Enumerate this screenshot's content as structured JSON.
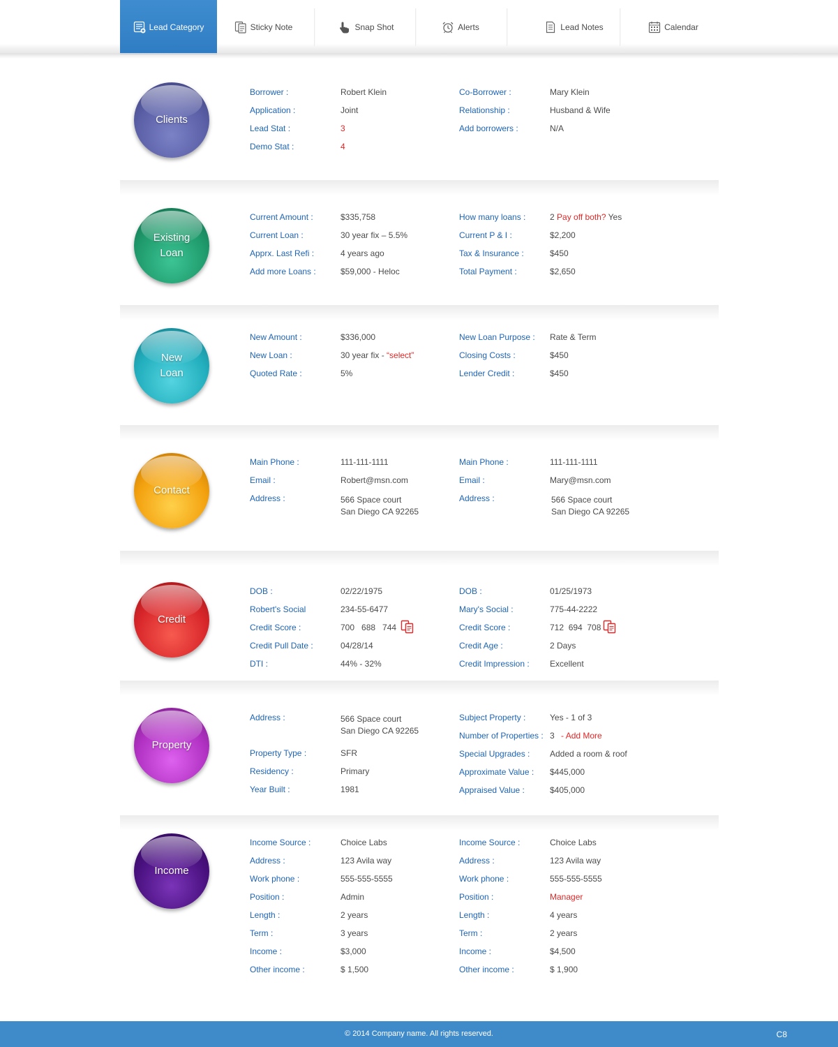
{
  "nav": {
    "tabs": [
      {
        "label": "Lead Category",
        "icon": "list-icon"
      },
      {
        "label": "Sticky Note",
        "icon": "notes-icon"
      },
      {
        "label": "Snap Shot",
        "icon": "pointer-icon"
      },
      {
        "label": "Alerts",
        "icon": "alarm-clock-icon"
      },
      {
        "label": "Lead Notes",
        "icon": "document-icon"
      },
      {
        "label": "Calendar",
        "icon": "calendar-icon"
      }
    ]
  },
  "sections": {
    "clients": {
      "title": "Clients",
      "left": [
        {
          "label": "Borrower :",
          "value": "Robert Klein"
        },
        {
          "label": "Application :",
          "value": "Joint"
        },
        {
          "label": "Lead Stat :",
          "value": "3"
        },
        {
          "label": "Demo Stat :",
          "value": "4"
        }
      ],
      "right": [
        {
          "label": "Co-Borrower :",
          "value": "Mary Klein"
        },
        {
          "label": "Relationship :",
          "value": "Husband & Wife"
        },
        {
          "label": "Add borrowers :",
          "value": "N/A"
        }
      ]
    },
    "existing_loan": {
      "title": "Existing\nLoan",
      "left": [
        {
          "label": "Current Amount :",
          "value": "$335,758"
        },
        {
          "label": "Current Loan :",
          "value": "30 year fix – 5.5%"
        },
        {
          "label": "Apprx. Last Refi :",
          "value": "4 years ago"
        },
        {
          "label": "Add more Loans :",
          "value": "$59,000 - Heloc"
        }
      ],
      "right": [
        {
          "label": "How many loans :",
          "value": "2",
          "value_red": "Pay off both?",
          "value_tail": "Yes"
        },
        {
          "label": "Current P & I :",
          "value": "$2,200"
        },
        {
          "label": "Tax & Insurance :",
          "value": "$450"
        },
        {
          "label": "Total Payment :",
          "value": "$2,650"
        }
      ]
    },
    "new_loan": {
      "title": "New\nLoan",
      "left": [
        {
          "label": "New Amount :",
          "value": "$336,000"
        },
        {
          "label": "New Loan :",
          "value": "30 year fix -",
          "value_red": "“select”"
        },
        {
          "label": "Quoted Rate :",
          "value": "5%"
        }
      ],
      "right": [
        {
          "label": "New Loan Purpose :",
          "value": "Rate & Term"
        },
        {
          "label": "Closing Costs :",
          "value": "$450"
        },
        {
          "label": "Lender Credit :",
          "value": "$450"
        }
      ]
    },
    "contact": {
      "title": "Contact",
      "left": [
        {
          "label": "Main Phone :",
          "value": "111-111-1111"
        },
        {
          "label": "Email :",
          "value": "Robert@msn.com"
        },
        {
          "label": "Address :",
          "value": "566 Space court",
          "value2": "San Diego CA 92265"
        }
      ],
      "right": [
        {
          "label": "Main Phone :",
          "value": "111-111-1111"
        },
        {
          "label": "Email :",
          "value": "Mary@msn.com"
        },
        {
          "label": "Address :",
          "value": "566 Space court",
          "value2": "San Diego CA 92265"
        }
      ]
    },
    "credit": {
      "title": "Credit",
      "left": [
        {
          "label": "DOB :",
          "value": "02/22/1975"
        },
        {
          "label": "Robert's Social",
          "value": "234-55-6477"
        },
        {
          "label": "Credit Score :",
          "value": "700   688   744"
        },
        {
          "label": "Credit Pull Date :",
          "value": "04/28/14"
        },
        {
          "label": "DTI :",
          "value": "44% - 32%"
        }
      ],
      "right": [
        {
          "label": "DOB :",
          "value": "01/25/1973"
        },
        {
          "label": "Mary's Social :",
          "value": "775-44-2222"
        },
        {
          "label": "Credit Score :",
          "value": "712  694  708"
        },
        {
          "label": "Credit Age :",
          "value": "2 Days"
        },
        {
          "label": "Credit Impression :",
          "value": "Excellent"
        }
      ]
    },
    "property": {
      "title": "Property",
      "left": [
        {
          "label": "Address :",
          "value": "566 Space court",
          "value2": "San Diego CA 92265"
        },
        {
          "label": "Property Type :",
          "value": "SFR"
        },
        {
          "label": "Residency :",
          "value": "Primary"
        },
        {
          "label": "Year Built :",
          "value": "1981"
        }
      ],
      "right": [
        {
          "label": "Subject Property :",
          "value": "Yes - 1 of 3"
        },
        {
          "label": "Number of Properties :",
          "value": "3",
          "value_red": "- Add More"
        },
        {
          "label": "Special Upgrades :",
          "value": "Added a room & roof"
        },
        {
          "label": "Approximate Value :",
          "value": "$445,000"
        },
        {
          "label": "Appraised Value :",
          "value": "$405,000"
        }
      ]
    },
    "income": {
      "title": "Income",
      "left": [
        {
          "label": "Income Source :",
          "value": "Choice Labs"
        },
        {
          "label": "Address :",
          "value": "123 Avila way"
        },
        {
          "label": "Work phone :",
          "value": "555-555-5555"
        },
        {
          "label": "Position :",
          "value": "Admin"
        },
        {
          "label": "Length :",
          "value": "2 years"
        },
        {
          "label": "Term :",
          "value": "3 years"
        },
        {
          "label": "Income :",
          "value": "$3,000"
        },
        {
          "label": "Other income :",
          "value": "$ 1,500"
        }
      ],
      "right": [
        {
          "label": "Income Source :",
          "value": "Choice Labs"
        },
        {
          "label": "Address :",
          "value": "123 Avila way"
        },
        {
          "label": "Work phone :",
          "value": "555-555-5555"
        },
        {
          "label": "Position :",
          "value_red": "Manager"
        },
        {
          "label": "Length :",
          "value": "4 years"
        },
        {
          "label": "Term :",
          "value": "2 years"
        },
        {
          "label": "Income :",
          "value": "$4,500"
        },
        {
          "label": "Other income :",
          "value": "$ 1,900"
        }
      ]
    }
  },
  "footer": {
    "copyright": "© 2014 Company name. All rights reserved.",
    "code": "C8"
  },
  "colors": {
    "accent": "#3a88c9",
    "label": "#1e64b4",
    "highlight": "#e02727",
    "clients_orb": "#5a5fa6",
    "existing_loan_orb": "#1f9a6c",
    "new_loan_orb": "#22aebd",
    "contact_orb": "#f3a10e",
    "credit_orb": "#d8262a",
    "property_orb": "#b031c2",
    "income_orb": "#4a1180"
  }
}
